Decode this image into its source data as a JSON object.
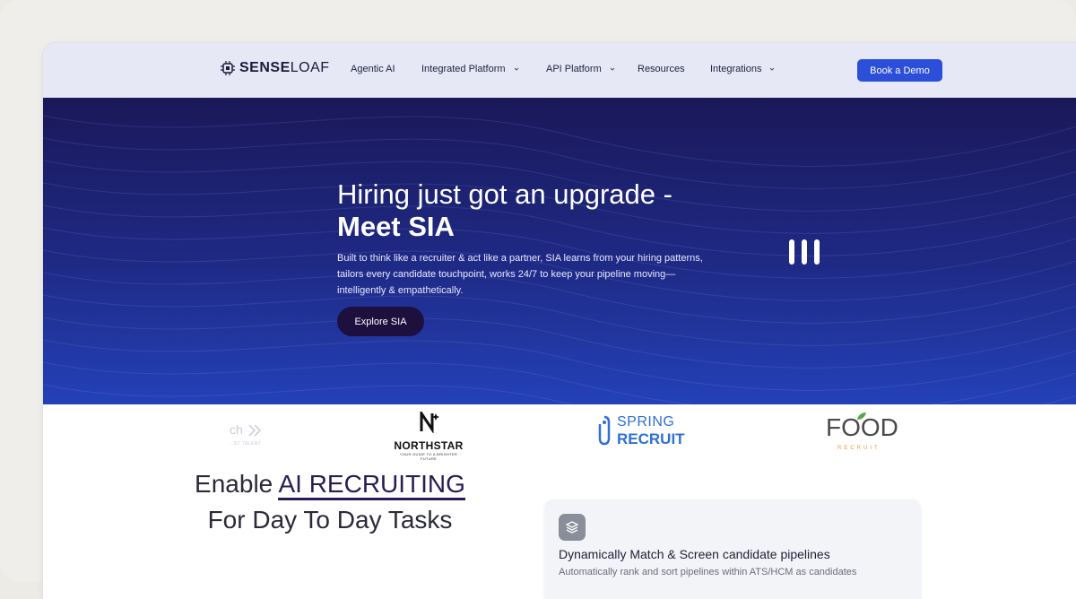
{
  "brand": {
    "name_bold": "SENSE",
    "name_light": "LOAF",
    "logo_icon": "chip-icon"
  },
  "nav": {
    "items": [
      {
        "label": "Agentic AI",
        "has_dropdown": false
      },
      {
        "label": "Integrated Platform",
        "has_dropdown": true
      },
      {
        "label": "API Platform",
        "has_dropdown": true
      },
      {
        "label": "Resources",
        "has_dropdown": false
      },
      {
        "label": "Integrations",
        "has_dropdown": true
      }
    ],
    "cta_label": "Book a Demo"
  },
  "hero": {
    "title_line1": "Hiring just got an upgrade -",
    "title_line2": "Meet SIA",
    "description": "Built to think like a recruiter & act like a partner, SIA learns from your hiring patterns, tailors every candidate touchpoint, works 24/7 to keep your pipeline moving—intelligently & empathetically.",
    "button_label": "Explore SIA",
    "pause_icon": "pause-icon"
  },
  "logos": {
    "partial": {
      "text": "ch",
      "sub": "...ST TALENT"
    },
    "northstar": {
      "name": "NORTHSTAR",
      "tagline": "YOUR GUIDE TO A BRIGHTER FUTURE"
    },
    "spring_recruit": {
      "line1": "SPRING",
      "line2": "RECRUIT"
    },
    "food_recruit": {
      "name": "FOOD",
      "sub": "RECRUIT"
    }
  },
  "section": {
    "title_prefix": "Enable ",
    "title_highlight": "AI RECRUITING",
    "title_line2": "For Day To Day Tasks"
  },
  "feature": {
    "icon": "layers-icon",
    "title": "Dynamically Match & Screen candidate pipelines",
    "description": "Automatically rank and sort pipelines within ATS/HCM as candidates"
  },
  "colors": {
    "accent": "#2b4fd8",
    "hero_dark": "#1a1858",
    "hero_light": "#2441b8",
    "button_dark": "#1d0f3e"
  }
}
